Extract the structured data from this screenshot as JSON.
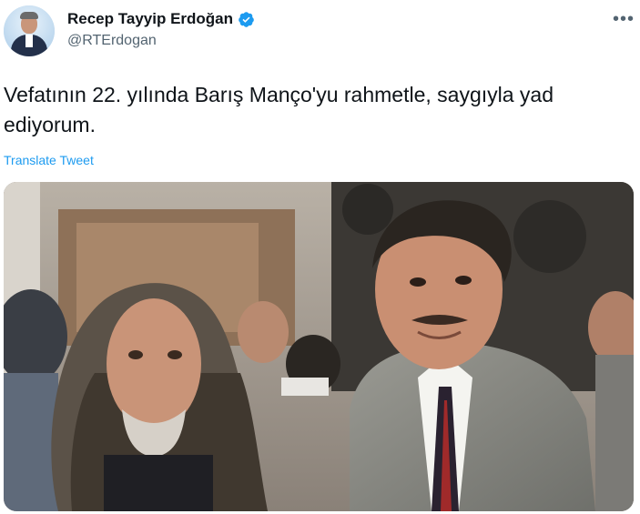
{
  "author": {
    "display_name": "Recep Tayyip Erdoğan",
    "handle": "@RTErdogan"
  },
  "tweet": {
    "text": "Vefatının 22. yılında Barış Manço'yu rahmetle, saygıyla yad ediyorum.",
    "translate_label": "Translate Tweet"
  },
  "icons": {
    "more": "more-options-icon",
    "verified": "verified-badge-icon"
  },
  "colors": {
    "link": "#1d9bf0",
    "verified": "#1d9bf0",
    "secondary_text": "#536471"
  }
}
